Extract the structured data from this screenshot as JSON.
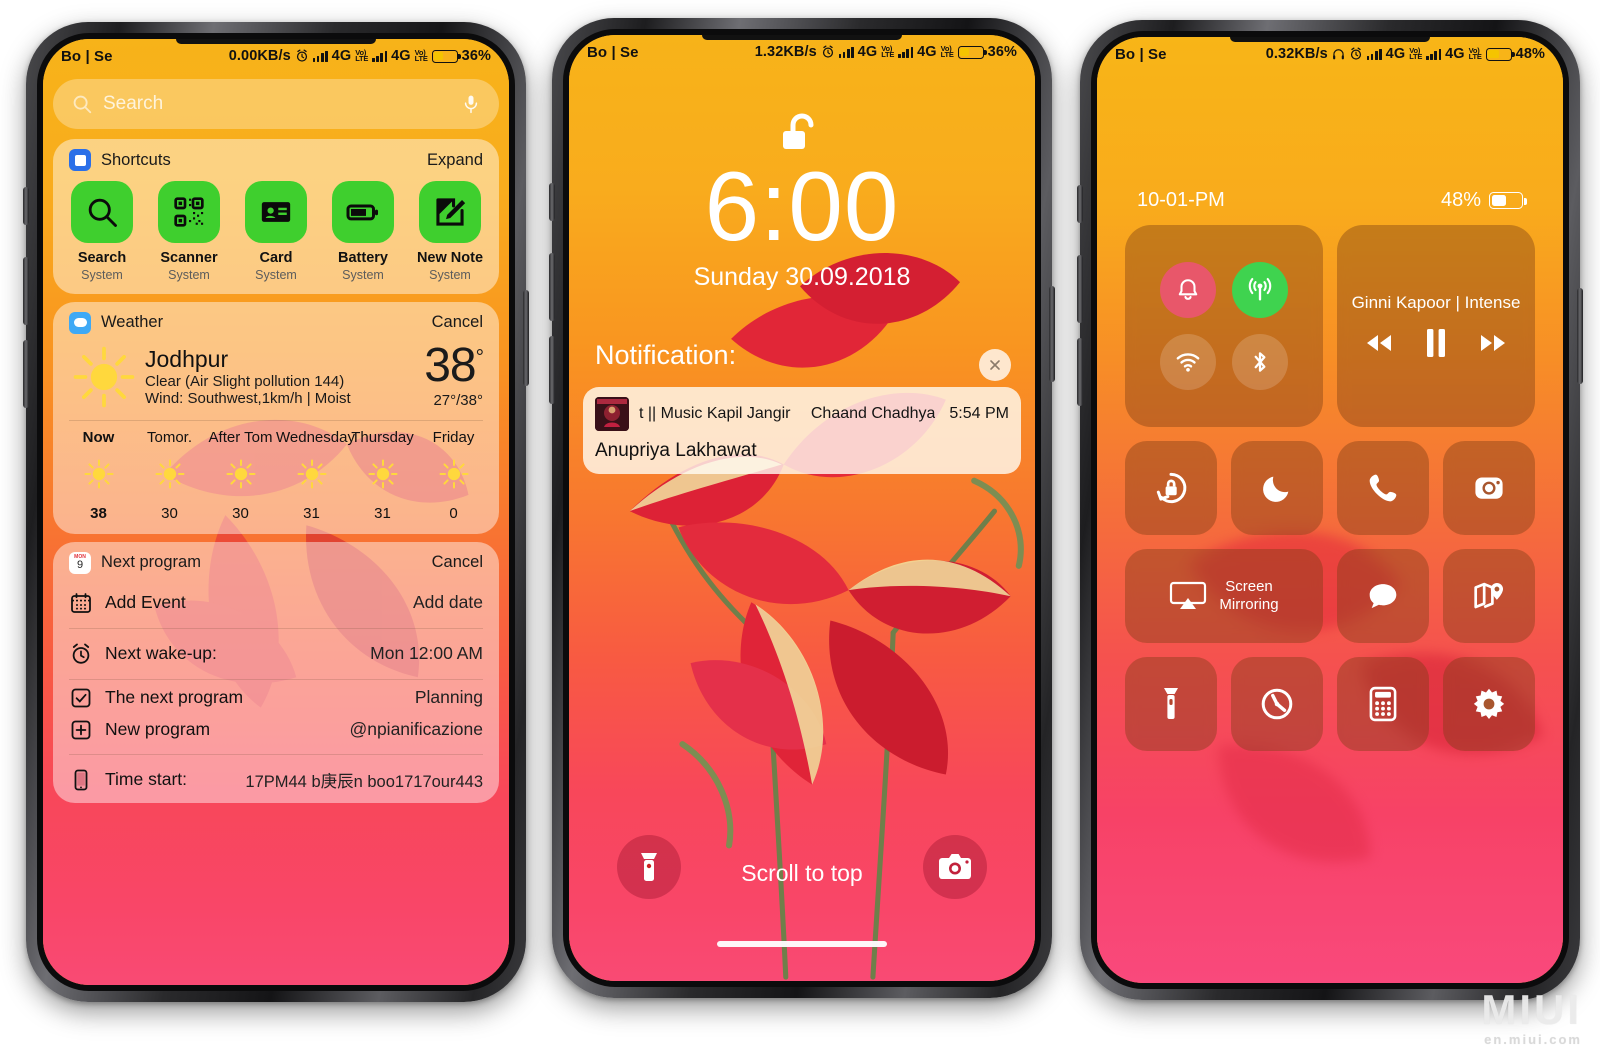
{
  "watermark": {
    "brand": "MIUI",
    "site": "en.miui.com"
  },
  "phone1": {
    "status": {
      "left": "Bo | Se",
      "speed": "0.00KB/s",
      "net1": "4G",
      "net2": "4G",
      "volte": "VoLTE",
      "battery": "36%"
    },
    "search": {
      "placeholder": "Search"
    },
    "shortcuts_card": {
      "title": "Shortcuts",
      "action": "Expand"
    },
    "shortcuts": [
      {
        "name": "Search",
        "sub": "System",
        "icon": "search-icon"
      },
      {
        "name": "Scanner",
        "sub": "System",
        "icon": "qr-scanner-icon"
      },
      {
        "name": "Card",
        "sub": "System",
        "icon": "card-icon"
      },
      {
        "name": "Battery",
        "sub": "System",
        "icon": "battery-icon"
      },
      {
        "name": "New Note",
        "sub": "System",
        "icon": "new-note-icon"
      }
    ],
    "weather_card": {
      "title": "Weather",
      "action": "Cancel"
    },
    "weather": {
      "city": "Jodhpur",
      "condition": "Clear (Air Slight pollution 144)",
      "wind": "Wind: Southwest,1km/h | Moist",
      "temp": "38",
      "degree": "°",
      "range": "27°/38°"
    },
    "forecast": {
      "days": [
        "Now",
        "Tomor.",
        "After Tom",
        "Wednesday",
        "Thursday",
        "Friday"
      ],
      "temps": [
        "38",
        "30",
        "30",
        "31",
        "31",
        "0"
      ]
    },
    "calendar_card": {
      "title": "Next program",
      "action": "Cancel",
      "day_badge": "9"
    },
    "calendar_rows": [
      {
        "label": "Add Event",
        "value": "Add date",
        "icon": "calendar-icon"
      },
      {
        "label": "Next wake-up:",
        "value": "Mon 12:00 AM",
        "icon": "alarm-icon"
      },
      {
        "label": "The next program",
        "value": "Planning",
        "icon": "checkbox-icon"
      },
      {
        "label": "New program",
        "value": "@npianificazione",
        "icon": "plus-box-icon"
      },
      {
        "label": "Time start:",
        "value": "17PM44 b庚辰n boo1717our443",
        "icon": "phone-icon"
      }
    ]
  },
  "phone2": {
    "status": {
      "left": "Bo | Se",
      "speed": "1.32KB/s",
      "net1": "4G",
      "net2": "4G",
      "volte": "VoLTE",
      "battery": "36%"
    },
    "clock": "6:00",
    "date": "Sunday 30.09.2018",
    "notification_title": "Notification:",
    "notification": {
      "app": "t || Music Kapil Jangir",
      "song": "Chaand Chadhya",
      "time": "5:54 PM",
      "body": "Anupriya Lakhawat"
    },
    "scroll_hint": "Scroll to top",
    "torch_icon": "flashlight-icon",
    "camera_icon": "camera-icon"
  },
  "phone3": {
    "status": {
      "left": "Bo | Se",
      "speed": "0.32KB/s",
      "net1": "4G",
      "net2": "4G",
      "volte": "VoLTE",
      "battery": "48%"
    },
    "header": {
      "time": "10-01-PM",
      "battery": "48%"
    },
    "toggles": [
      {
        "name": "silent-toggle",
        "icon": "bell-icon",
        "state": "on-red"
      },
      {
        "name": "cellular-toggle",
        "icon": "antenna-icon",
        "state": "on-green"
      },
      {
        "name": "wifi-toggle",
        "icon": "wifi-icon",
        "state": "off"
      },
      {
        "name": "bluetooth-toggle",
        "icon": "bluetooth-icon",
        "state": "off"
      }
    ],
    "media": {
      "title": "Ginni Kapoor | Intense",
      "prev": "rewind-icon",
      "play": "pause-icon",
      "next": "forward-icon"
    },
    "tiles": [
      {
        "name": "rotation-lock-tile",
        "icon": "rotation-lock-icon",
        "label": ""
      },
      {
        "name": "do-not-disturb-tile",
        "icon": "moon-icon",
        "label": ""
      },
      {
        "name": "phone-tile",
        "icon": "handset-icon",
        "label": ""
      },
      {
        "name": "camera-tile",
        "icon": "camera-icon",
        "label": ""
      },
      {
        "name": "screen-mirroring-tile",
        "icon": "airplay-icon",
        "label": "Screen\nMirroring"
      },
      {
        "name": "messages-tile",
        "icon": "chat-bubble-icon",
        "label": ""
      },
      {
        "name": "maps-tile",
        "icon": "map-pin-icon",
        "label": ""
      },
      {
        "name": "flashlight-tile",
        "icon": "flashlight-icon",
        "label": ""
      },
      {
        "name": "timer-tile",
        "icon": "timer-icon",
        "label": ""
      },
      {
        "name": "calculator-tile",
        "icon": "calculator-icon",
        "label": ""
      },
      {
        "name": "settings-tile",
        "icon": "gear-icon",
        "label": ""
      }
    ]
  }
}
